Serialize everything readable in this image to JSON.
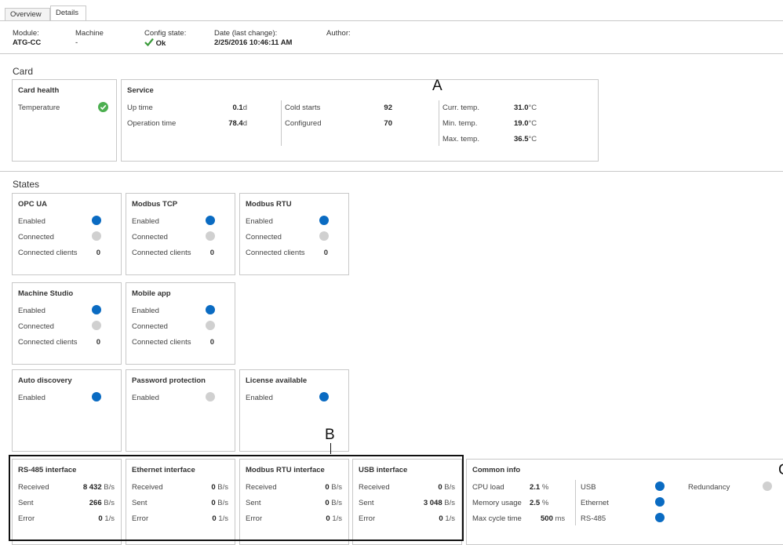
{
  "tabs": [
    {
      "label": "Overview"
    },
    {
      "label": "Details"
    }
  ],
  "header": {
    "module_label": "Module:",
    "module_value": "ATG-CC",
    "machine_label": "Machine",
    "machine_value": "-",
    "config_label": "Config state:",
    "config_value": "Ok",
    "date_label": "Date (last change):",
    "date_value": "2/25/2016 10:46:11 AM",
    "author_label": "Author:"
  },
  "card": {
    "title": "Card",
    "health": {
      "title": "Card health",
      "temperature_label": "Temperature"
    },
    "service": {
      "title": "Service",
      "uptime_label": "Up time",
      "uptime_value": "0.1",
      "uptime_unit": "d",
      "optime_label": "Operation time",
      "optime_value": "78.4",
      "optime_unit": "d",
      "cold_label": "Cold starts",
      "cold_value": "92",
      "configured_label": "Configured",
      "configured_value": "70",
      "curr_label": "Curr. temp.",
      "curr_value": "31.0",
      "curr_unit": "°C",
      "min_label": "Min. temp.",
      "min_value": "19.0",
      "min_unit": "°C",
      "max_label": "Max. temp.",
      "max_value": "36.5",
      "max_unit": "°C"
    }
  },
  "states": {
    "title": "States",
    "opcua": {
      "title": "OPC UA",
      "enabled": "Enabled",
      "connected": "Connected",
      "clients": "Connected clients",
      "clients_value": "0"
    },
    "modbus_tcp": {
      "title": "Modbus TCP",
      "enabled": "Enabled",
      "connected": "Connected",
      "clients": "Connected clients",
      "clients_value": "0"
    },
    "modbus_rtu": {
      "title": "Modbus RTU",
      "enabled": "Enabled",
      "connected": "Connected",
      "clients": "Connected clients",
      "clients_value": "0"
    },
    "machine_studio": {
      "title": "Machine Studio",
      "enabled": "Enabled",
      "connected": "Connected",
      "clients": "Connected clients",
      "clients_value": "0"
    },
    "mobile_app": {
      "title": "Mobile app",
      "enabled": "Enabled",
      "connected": "Connected",
      "clients": "Connected clients",
      "clients_value": "0"
    },
    "auto_discovery": {
      "title": "Auto discovery",
      "enabled": "Enabled"
    },
    "password_protection": {
      "title": "Password protection",
      "enabled": "Enabled"
    },
    "license_available": {
      "title": "License available",
      "enabled": "Enabled"
    }
  },
  "interfaces": {
    "rs485": {
      "title": "RS-485 interface",
      "received": "Received",
      "received_value": "8 432",
      "received_unit": "B/s",
      "sent": "Sent",
      "sent_value": "266",
      "sent_unit": "B/s",
      "error": "Error",
      "error_value": "0",
      "error_unit": "1/s"
    },
    "ethernet": {
      "title": "Ethernet interface",
      "received": "Received",
      "received_value": "0",
      "received_unit": "B/s",
      "sent": "Sent",
      "sent_value": "0",
      "sent_unit": "B/s",
      "error": "Error",
      "error_value": "0",
      "error_unit": "1/s"
    },
    "modbus_rtu": {
      "title": "Modbus RTU interface",
      "received": "Received",
      "received_value": "0",
      "received_unit": "B/s",
      "sent": "Sent",
      "sent_value": "0",
      "sent_unit": "B/s",
      "error": "Error",
      "error_value": "0",
      "error_unit": "1/s"
    },
    "usb": {
      "title": "USB interface",
      "received": "Received",
      "received_value": "0",
      "received_unit": "B/s",
      "sent": "Sent",
      "sent_value": "3 048",
      "sent_unit": "B/s",
      "error": "Error",
      "error_value": "0",
      "error_unit": "1/s"
    }
  },
  "common": {
    "title": "Common info",
    "cpu_label": "CPU load",
    "cpu_value": "2.1",
    "cpu_unit": "%",
    "mem_label": "Memory usage",
    "mem_value": "2.5",
    "mem_unit": "%",
    "cycle_label": "Max cycle time",
    "cycle_value": "500",
    "cycle_unit": "ms",
    "usb_label": "USB",
    "ethernet_label": "Ethernet",
    "rs485_label": "RS-485",
    "redundancy_label": "Redundancy"
  },
  "callouts": {
    "a": "A",
    "b": "B",
    "c": "C"
  },
  "colors": {
    "enabled_dot": "#0a6bc2",
    "disabled_dot": "#d0d0d0",
    "ok_check": "#3a9a3a",
    "health_ok": "#4caf50"
  }
}
